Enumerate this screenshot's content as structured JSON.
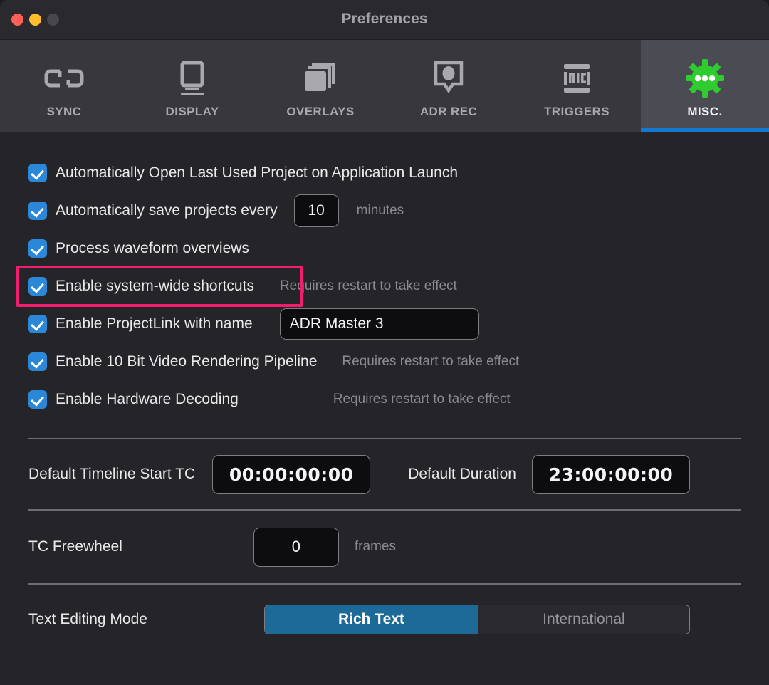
{
  "window": {
    "title": "Preferences",
    "traffic_lights": [
      {
        "name": "close-button",
        "color": "#ff5f57"
      },
      {
        "name": "minimize-button",
        "color": "#ffbd2e"
      },
      {
        "name": "zoom-button",
        "color": "#48484c"
      }
    ]
  },
  "toolbar": {
    "active_tab": "MISC.",
    "accent_color": "#1478d0",
    "tabs": [
      {
        "label": "SYNC",
        "icon": "sync-link-icon",
        "active": false
      },
      {
        "label": "DISPLAY",
        "icon": "monitor-icon",
        "active": false
      },
      {
        "label": "OVERLAYS",
        "icon": "layers-icon",
        "active": false
      },
      {
        "label": "ADR REC",
        "icon": "record-bubble-icon",
        "active": false
      },
      {
        "label": "TRIGGERS",
        "icon": "midi-icon",
        "active": false
      },
      {
        "label": "MISC.",
        "icon": "gear-dots-icon",
        "active": true
      }
    ]
  },
  "misc": {
    "checkbox_color": "#2b88d8",
    "highlight_color": "#f31d6e",
    "options": [
      {
        "label": "Automatically Open Last Used Project on Application Launch",
        "checked": true,
        "hint": "",
        "field": null,
        "suffix": "",
        "highlighted": false
      },
      {
        "label": "Automatically save projects every",
        "checked": true,
        "hint": "",
        "field": "10",
        "suffix": "minutes",
        "highlighted": false
      },
      {
        "label": "Process waveform overviews",
        "checked": true,
        "hint": "",
        "field": null,
        "suffix": "",
        "highlighted": false
      },
      {
        "label": "Enable system-wide shortcuts",
        "checked": true,
        "hint": "Requires restart to take effect",
        "field": null,
        "suffix": "",
        "highlighted": true
      },
      {
        "label": "Enable ProjectLink with name",
        "checked": true,
        "hint": "",
        "field": "ADR Master 3",
        "suffix": "",
        "highlighted": false
      },
      {
        "label": "Enable 10 Bit Video Rendering Pipeline",
        "checked": true,
        "hint": "Requires restart to take effect",
        "field": null,
        "suffix": "",
        "highlighted": false
      },
      {
        "label": "Enable Hardware Decoding",
        "checked": true,
        "hint": "Requires restart to take effect",
        "field": null,
        "suffix": "",
        "highlighted": false
      }
    ],
    "timecode": {
      "start_label": "Default Timeline Start TC",
      "start_value": "00:00:00:00",
      "duration_label": "Default Duration",
      "duration_value": "23:00:00:00"
    },
    "freewheel": {
      "label": "TC Freewheel",
      "value": "0",
      "suffix": "frames"
    },
    "text_editing_mode": {
      "label": "Text Editing Mode",
      "selected": "Rich Text",
      "options": [
        "Rich Text",
        "International"
      ],
      "selected_color": "#1d6998"
    }
  }
}
